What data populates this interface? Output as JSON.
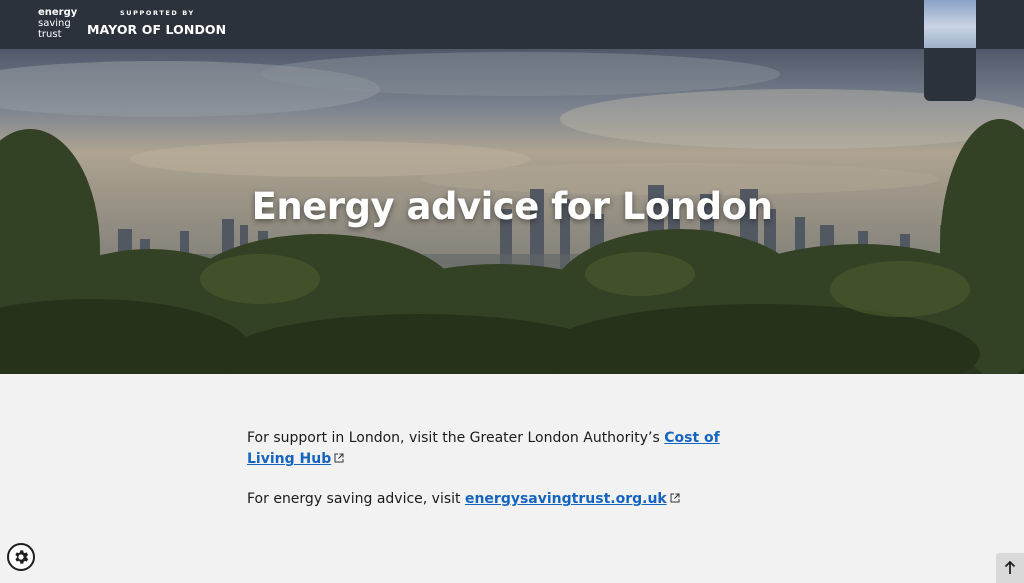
{
  "header": {
    "logo_lines": [
      "energy",
      "saving",
      "trust"
    ],
    "supported_by": "SUPPORTED BY",
    "partner": "MAYOR OF LONDON"
  },
  "hero": {
    "title": "Energy advice for London"
  },
  "content": {
    "p1_text": "For support in London, visit the Greater London Authority’s ",
    "p1_link": "Cost of Living Hub",
    "p2_text": "For energy saving advice, visit ",
    "p2_link": "energysavingtrust.org.uk"
  },
  "icons": {
    "cookie": "gear-icon",
    "back_to_top": "arrow-up-icon",
    "external": "external-link-icon"
  },
  "colors": {
    "header_bg": "#2b323c",
    "link": "#1565c0",
    "page_bg": "#f2f2f2"
  }
}
